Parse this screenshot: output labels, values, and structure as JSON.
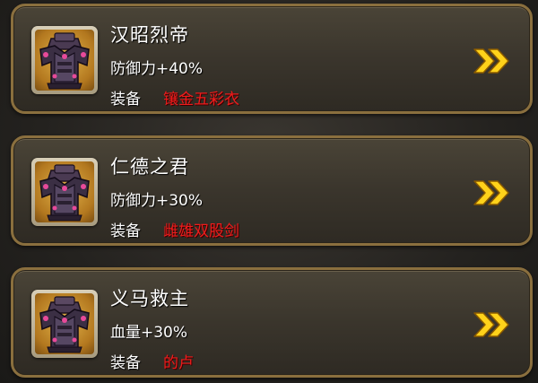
{
  "colors": {
    "frame_gold": "#8a6f3e",
    "panel": "#3a352c",
    "equip_red": "#ee1c1c",
    "arrow_yellow": "#ffd21a"
  },
  "entries": [
    {
      "title": "汉昭烈帝",
      "attribute": "防御力+40%",
      "equip_label": "装备",
      "equip_item": "镶金五彩衣",
      "icon": "armor-icon",
      "action_icon": "double-chevron-right-icon"
    },
    {
      "title": "仁德之君",
      "attribute": "防御力+30%",
      "equip_label": "装备",
      "equip_item": "雌雄双股剑",
      "icon": "armor-icon",
      "action_icon": "double-chevron-right-icon"
    },
    {
      "title": "义马救主",
      "attribute": "血量+30%",
      "equip_label": "装备",
      "equip_item": "的卢",
      "icon": "armor-icon",
      "action_icon": "double-chevron-right-icon"
    }
  ]
}
